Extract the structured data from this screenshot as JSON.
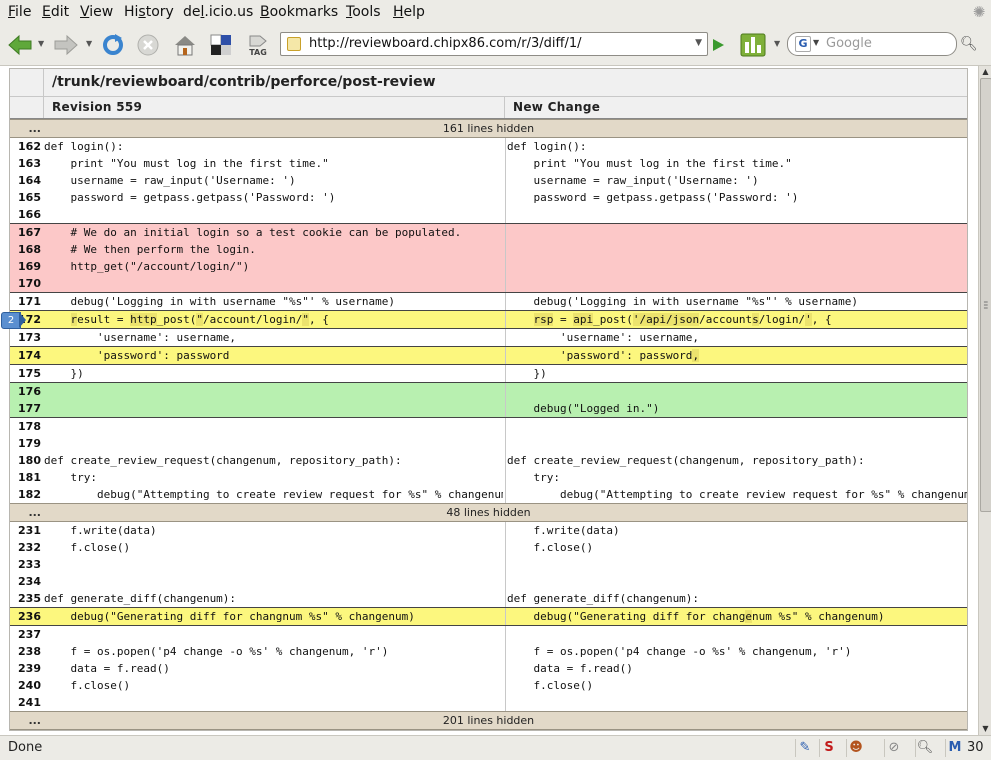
{
  "menu": [
    {
      "pre": "",
      "u": "F",
      "post": "ile"
    },
    {
      "pre": "",
      "u": "E",
      "post": "dit"
    },
    {
      "pre": "",
      "u": "V",
      "post": "iew"
    },
    {
      "pre": "Hi",
      "u": "s",
      "post": "tory"
    },
    {
      "pre": "de",
      "u": "l",
      "post": ".icio.us"
    },
    {
      "pre": "",
      "u": "B",
      "post": "ookmarks"
    },
    {
      "pre": "",
      "u": "T",
      "post": "ools"
    },
    {
      "pre": "",
      "u": "H",
      "post": "elp"
    }
  ],
  "toolbar": {
    "url": "http://reviewboard.chipx86.com/r/3/diff/1/",
    "search_placeholder": "Google",
    "tag_label": "TAG"
  },
  "diff": {
    "file": "/trunk/reviewboard/contrib/perforce/post-review",
    "left_rev": "Revision 559",
    "right_rev": "New Change",
    "gap1": "161 lines hidden",
    "gap2": "48 lines hidden",
    "gap3": "201 lines hidden",
    "gap_dots": "...",
    "comment_count": "2",
    "lines": {
      "l162": {
        "n": "162",
        "l": "def login():",
        "r": "def login():"
      },
      "l163": {
        "n": "163",
        "l": "    print \"You must log in the first time.\"",
        "r": "    print \"You must log in the first time.\""
      },
      "l164": {
        "n": "164",
        "l": "    username = raw_input('Username: ')",
        "r": "    username = raw_input('Username: ')"
      },
      "l165": {
        "n": "165",
        "l": "    password = getpass.getpass('Password: ')",
        "r": "    password = getpass.getpass('Password: ')"
      },
      "l166": {
        "n": "166",
        "l": "",
        "r": ""
      },
      "l167": {
        "n": "167",
        "l": "    # We do an initial login so a test cookie can be populated.",
        "r": ""
      },
      "l168": {
        "n": "168",
        "l": "    # We then perform the login.",
        "r": ""
      },
      "l169": {
        "n": "169",
        "l": "    http_get(\"/account/login/\")",
        "r": ""
      },
      "l170": {
        "n": "170",
        "l": "",
        "r": ""
      },
      "l171": {
        "n": "171",
        "l": "    debug('Logging in with username \"%s\"' % username)",
        "r": "    debug('Logging in with username \"%s\"' % username)"
      },
      "l172": {
        "n": "172",
        "l_a": "    ",
        "l_b": "r",
        "l_c": "esult = ",
        "l_d": "http",
        "l_e": "_post(",
        "l_f": "\"",
        "l_g": "/account/login/",
        "l_h": "\"",
        "l_i": ", {",
        "r_a": "    ",
        "r_b": "rsp",
        "r_c": " = ",
        "r_d": "api",
        "r_e": "_post(",
        "r_f": "'/api/json",
        "r_g": "/account",
        "r_h": "s",
        "r_i": "/login/",
        "r_j": "'",
        "r_k": ", {"
      },
      "l173": {
        "n": "173",
        "l": "        'username': username,",
        "r": "        'username': username,"
      },
      "l174": {
        "n": "174",
        "l": "        'password': password",
        "r_a": "        'password': password",
        "r_b": ","
      },
      "l175": {
        "n": "175",
        "l": "    })",
        "r": "    })"
      },
      "l176": {
        "n": "176",
        "l": "",
        "r": ""
      },
      "l177": {
        "n": "177",
        "l": "",
        "r": "    debug(\"Logged in.\")"
      },
      "l178": {
        "n": "178",
        "l": "",
        "r": ""
      },
      "l179": {
        "n": "179",
        "l": "",
        "r": ""
      },
      "l180": {
        "n": "180",
        "l": "def create_review_request(changenum, repository_path):",
        "r": "def create_review_request(changenum, repository_path):"
      },
      "l181": {
        "n": "181",
        "l": "    try:",
        "r": "    try:"
      },
      "l182": {
        "n": "182",
        "l": "        debug(\"Attempting to create review request for %s\" % changenum)",
        "r": "        debug(\"Attempting to create review request for %s\" % changenum)"
      },
      "l231": {
        "n": "231",
        "l": "    f.write(data)",
        "r": "    f.write(data)"
      },
      "l232": {
        "n": "232",
        "l": "    f.close()",
        "r": "    f.close()"
      },
      "l233": {
        "n": "233",
        "l": "",
        "r": ""
      },
      "l234": {
        "n": "234",
        "l": "",
        "r": ""
      },
      "l235": {
        "n": "235",
        "l": "def generate_diff(changenum):",
        "r": "def generate_diff(changenum):"
      },
      "l236": {
        "n": "236",
        "l": "    debug(\"Generating diff for changnum %s\" % changenum)",
        "r_a": "    debug(\"Generating diff for chang",
        "r_b": "e",
        "r_c": "num %s\" % changenum)"
      },
      "l237": {
        "n": "237",
        "l": "",
        "r": ""
      },
      "l238": {
        "n": "238",
        "l": "    f = os.popen('p4 change -o %s' % changenum, 'r')",
        "r": "    f = os.popen('p4 change -o %s' % changenum, 'r')"
      },
      "l239": {
        "n": "239",
        "l": "    data = f.read()",
        "r": "    data = f.read()"
      },
      "l240": {
        "n": "240",
        "l": "    f.close()",
        "r": "    f.close()"
      },
      "l241": {
        "n": "241",
        "l": "",
        "r": ""
      }
    }
  },
  "status": {
    "text": "Done",
    "mail_count": "30"
  },
  "colors": {
    "delete": "#fcc8c8",
    "insert": "#b8f0b0",
    "replace": "#fcf77e",
    "highlight": "#ece36e",
    "gap": "#e2d9c8"
  }
}
